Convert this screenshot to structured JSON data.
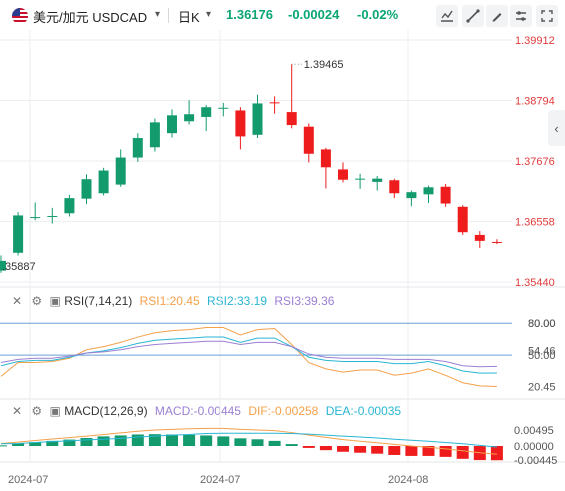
{
  "header": {
    "symbol": "美元/加元 USDCAD",
    "period": "日K",
    "price": "1.36176",
    "change": "-0.00024",
    "change_pct": "-0.02%"
  },
  "toolbar_icons": [
    "chart-type-icon",
    "draw-line-icon",
    "draw-pen-icon",
    "settings-icon",
    "fullscreen-icon",
    "close-icon"
  ],
  "main_chart": {
    "price_axis": [
      "1.39912",
      "1.38794",
      "1.37676",
      "1.36558",
      "1.35440"
    ],
    "high_label": "1.39465",
    "low_label": ".35887"
  },
  "rsi": {
    "name": "RSI(7,14,21)",
    "rsi1": "RSI1:20.45",
    "rsi2": "RSI2:33.19",
    "rsi3": "RSI3:39.36",
    "axis": [
      "80.00",
      "50.00",
      "20.45"
    ],
    "overlap_axis": [
      "80.00",
      "54.46"
    ],
    "colors": {
      "rsi1": "#f5a04a",
      "rsi2": "#29b6d2",
      "rsi3": "#9b7fd4"
    }
  },
  "macd": {
    "name": "MACD(12,26,9)",
    "macd": "MACD:-0.00445",
    "dif": "DIF:-0.00258",
    "dea": "DEA:-0.00035",
    "axis": [
      "0.00495",
      "0.00000",
      "-0.00445"
    ],
    "colors": {
      "macd": "#9b7fd4",
      "dif": "#f5a04a",
      "dea": "#29b6d2"
    }
  },
  "x_axis": [
    "2024-07",
    "2024-07",
    "2024-08"
  ],
  "candles": [
    {
      "o": 1.3565,
      "h": 1.3593,
      "l": 1.3561,
      "c": 1.3583
    },
    {
      "o": 1.3598,
      "h": 1.3673,
      "l": 1.3593,
      "c": 1.3667
    },
    {
      "o": 1.3664,
      "h": 1.3691,
      "l": 1.3658,
      "c": 1.3664
    },
    {
      "o": 1.3666,
      "h": 1.3681,
      "l": 1.3652,
      "c": 1.3666
    },
    {
      "o": 1.3671,
      "h": 1.3705,
      "l": 1.3665,
      "c": 1.3699
    },
    {
      "o": 1.3698,
      "h": 1.3743,
      "l": 1.3688,
      "c": 1.3734
    },
    {
      "o": 1.3708,
      "h": 1.3755,
      "l": 1.3704,
      "c": 1.375
    },
    {
      "o": 1.3724,
      "h": 1.3789,
      "l": 1.372,
      "c": 1.3774
    },
    {
      "o": 1.3774,
      "h": 1.3819,
      "l": 1.3766,
      "c": 1.381
    },
    {
      "o": 1.3793,
      "h": 1.3846,
      "l": 1.3785,
      "c": 1.3839
    },
    {
      "o": 1.3819,
      "h": 1.3863,
      "l": 1.3811,
      "c": 1.3852
    },
    {
      "o": 1.3841,
      "h": 1.388,
      "l": 1.3835,
      "c": 1.3854
    },
    {
      "o": 1.3849,
      "h": 1.3871,
      "l": 1.3823,
      "c": 1.3867
    },
    {
      "o": 1.3866,
      "h": 1.3875,
      "l": 1.385,
      "c": 1.3866
    },
    {
      "o": 1.3861,
      "h": 1.3867,
      "l": 1.3789,
      "c": 1.3813
    },
    {
      "o": 1.3816,
      "h": 1.389,
      "l": 1.381,
      "c": 1.3874
    },
    {
      "o": 1.3876,
      "h": 1.3887,
      "l": 1.3855,
      "c": 1.3875
    },
    {
      "o": 1.3858,
      "h": 1.39465,
      "l": 1.3828,
      "c": 1.3834
    },
    {
      "o": 1.3831,
      "h": 1.3837,
      "l": 1.3765,
      "c": 1.3781
    },
    {
      "o": 1.3789,
      "h": 1.3792,
      "l": 1.3717,
      "c": 1.3756
    },
    {
      "o": 1.3752,
      "h": 1.3765,
      "l": 1.3728,
      "c": 1.3733
    },
    {
      "o": 1.3735,
      "h": 1.3744,
      "l": 1.3716,
      "c": 1.3735
    },
    {
      "o": 1.3729,
      "h": 1.374,
      "l": 1.3713,
      "c": 1.3735
    },
    {
      "o": 1.3732,
      "h": 1.3735,
      "l": 1.3699,
      "c": 1.3708
    },
    {
      "o": 1.3699,
      "h": 1.3713,
      "l": 1.3684,
      "c": 1.371
    },
    {
      "o": 1.3706,
      "h": 1.3722,
      "l": 1.369,
      "c": 1.3719
    },
    {
      "o": 1.372,
      "h": 1.3725,
      "l": 1.3683,
      "c": 1.3689
    },
    {
      "o": 1.3683,
      "h": 1.3686,
      "l": 1.3631,
      "c": 1.3636
    },
    {
      "o": 1.3631,
      "h": 1.3638,
      "l": 1.3607,
      "c": 1.362
    },
    {
      "o": 1.3618,
      "h": 1.3623,
      "l": 1.3614,
      "c": 1.36176
    }
  ],
  "rsi_series": {
    "rsi1": [
      30,
      43,
      43,
      44,
      47,
      55,
      58,
      62,
      67,
      71,
      73,
      74,
      76,
      76,
      69,
      74,
      75,
      60,
      43,
      37,
      34,
      36,
      36,
      31,
      33,
      37,
      31,
      24,
      21,
      20.45
    ],
    "rsi2": [
      40,
      44,
      45,
      45,
      48,
      52,
      54,
      57,
      61,
      64,
      65,
      66,
      67,
      67,
      62,
      66,
      66,
      58,
      48,
      45,
      44,
      44,
      44,
      42,
      42,
      44,
      40,
      35,
      33,
      33.19
    ],
    "rsi3": [
      43,
      46,
      47,
      47,
      49,
      52,
      53,
      55,
      58,
      60,
      61,
      62,
      63,
      63,
      60,
      62,
      62,
      58,
      51,
      48,
      47,
      47,
      47,
      46,
      46,
      46,
      44,
      40,
      39,
      39.36
    ]
  },
  "macd_series": {
    "hist": [
      0.0002,
      0.0008,
      0.0012,
      0.0016,
      0.002,
      0.0025,
      0.003,
      0.0033,
      0.0036,
      0.0037,
      0.0036,
      0.0035,
      0.0033,
      0.003,
      0.0024,
      0.0021,
      0.0016,
      0.0006,
      -0.0006,
      -0.0013,
      -0.0018,
      -0.0021,
      -0.0024,
      -0.0028,
      -0.0031,
      -0.0031,
      -0.0034,
      -0.004,
      -0.0044,
      -0.00445
    ],
    "dif": [
      0.0008,
      0.0012,
      0.0017,
      0.0022,
      0.0026,
      0.0031,
      0.0036,
      0.0041,
      0.0046,
      0.005,
      0.0052,
      0.0054,
      0.0055,
      0.0055,
      0.0052,
      0.005,
      0.0048,
      0.0042,
      0.0034,
      0.0027,
      0.002,
      0.0015,
      0.001,
      0.0005,
      0.0,
      -0.0004,
      -0.0009,
      -0.0015,
      -0.0021,
      -0.00258
    ],
    "dea": [
      0.0007,
      0.0008,
      0.0011,
      0.0014,
      0.0016,
      0.0019,
      0.0021,
      0.0024,
      0.0028,
      0.0031,
      0.0034,
      0.0036,
      0.0039,
      0.004,
      0.004,
      0.004,
      0.004,
      0.0039,
      0.0037,
      0.0034,
      0.0031,
      0.0028,
      0.0025,
      0.0021,
      0.0018,
      0.0015,
      0.0011,
      0.0007,
      0.0002,
      -0.00035
    ]
  },
  "colors": {
    "up": "#139b6e",
    "down": "#ee1c1c",
    "grid": "#eceef1",
    "ref_line": "#6a9fd8"
  }
}
